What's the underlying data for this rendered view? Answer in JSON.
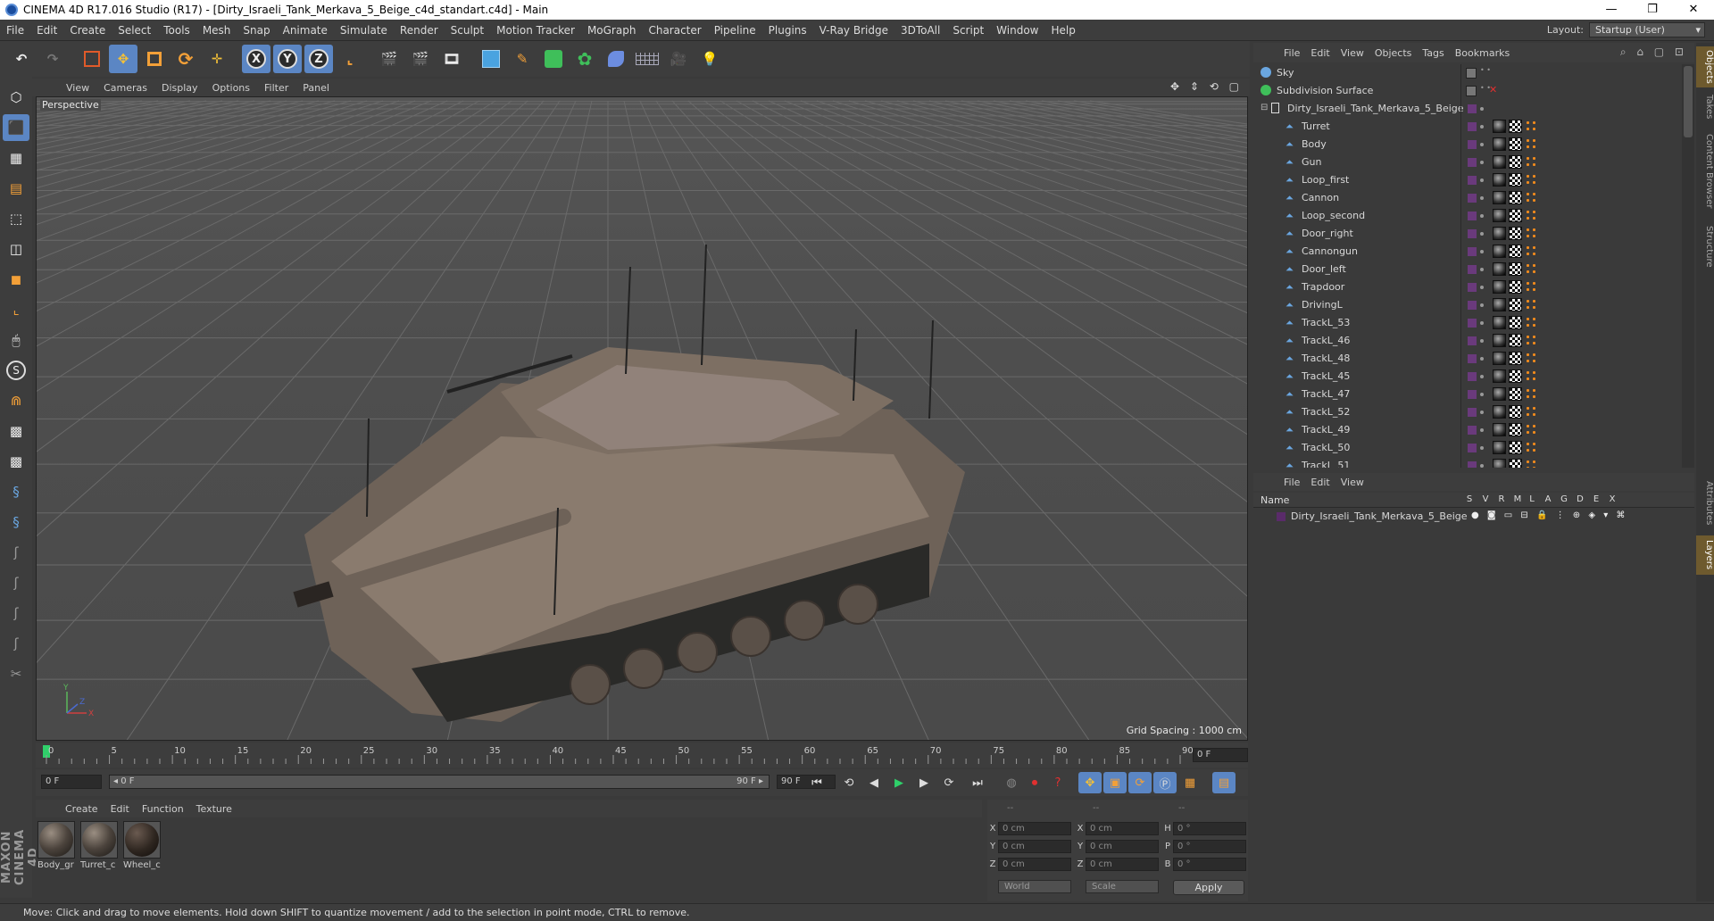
{
  "window": {
    "title": "CINEMA 4D R17.016 Studio (R17) - [Dirty_Israeli_Tank_Merkava_5_Beige_c4d_standart.c4d] - Main",
    "controls": [
      "—",
      "❐",
      "✕"
    ]
  },
  "menu": [
    "File",
    "Edit",
    "Create",
    "Select",
    "Tools",
    "Mesh",
    "Snap",
    "Animate",
    "Simulate",
    "Render",
    "Sculpt",
    "Motion Tracker",
    "MoGraph",
    "Character",
    "Pipeline",
    "Plugins",
    "V-Ray Bridge",
    "3DToAll",
    "Script",
    "Window",
    "Help"
  ],
  "layout": {
    "label": "Layout:",
    "value": "Startup (User)"
  },
  "toolbar": {
    "x_label": "X",
    "y_label": "Y",
    "z_label": "Z"
  },
  "left_tools": {
    "s_label": "S"
  },
  "viewport": {
    "menu": [
      "View",
      "Cameras",
      "Display",
      "Options",
      "Filter",
      "Panel"
    ],
    "camera_label": "Perspective",
    "grid_spacing": "Grid Spacing : 1000 cm",
    "axis_labels": {
      "y": "Y",
      "x": "X",
      "z": "Z"
    }
  },
  "timeline": {
    "ticks": [
      "0",
      "5",
      "10",
      "15",
      "20",
      "25",
      "30",
      "35",
      "40",
      "45",
      "50",
      "55",
      "60",
      "65",
      "70",
      "75",
      "80",
      "85",
      "90"
    ],
    "current_frame_box": "0 F",
    "start_field": "0 F",
    "range_start": "◂ 0 F",
    "range_end": "90 F ▸",
    "end_field": "90 F"
  },
  "material_manager": {
    "menu": [
      "Create",
      "Edit",
      "Function",
      "Texture"
    ],
    "materials": [
      {
        "name": "Body_gr"
      },
      {
        "name": "Turret_c"
      },
      {
        "name": "Wheel_c"
      }
    ]
  },
  "coordinates": {
    "header_dash1": "--",
    "header_dash2": "--",
    "header_dash3": "--",
    "rows": [
      {
        "a": "X",
        "a_val": "0 cm",
        "b": "X",
        "b_val": "0 cm",
        "c": "H",
        "c_val": "0 °"
      },
      {
        "a": "Y",
        "a_val": "0 cm",
        "b": "Y",
        "b_val": "0 cm",
        "c": "P",
        "c_val": "0 °"
      },
      {
        "a": "Z",
        "a_val": "0 cm",
        "b": "Z",
        "b_val": "0 cm",
        "c": "B",
        "c_val": "0 °"
      }
    ],
    "world_select": "World",
    "scale_select": "Scale",
    "apply_label": "Apply"
  },
  "status_text": "Move: Click and drag to move elements. Hold down SHIFT to quantize movement / add to the selection in point mode, CTRL to remove.",
  "branding": {
    "logo": "MAXON CINEMA 4D"
  },
  "object_manager": {
    "menu": [
      "File",
      "Edit",
      "View",
      "Objects",
      "Tags",
      "Bookmarks"
    ],
    "objects": [
      {
        "name": "Sky",
        "type": "sky"
      },
      {
        "name": "Subdivision Surface",
        "type": "subdiv"
      },
      {
        "name": "Dirty_Israeli_Tank_Merkava_5_Beige",
        "type": "null"
      },
      {
        "name": "Turret",
        "type": "poly"
      },
      {
        "name": "Body",
        "type": "poly"
      },
      {
        "name": "Gun",
        "type": "poly"
      },
      {
        "name": "Loop_first",
        "type": "poly"
      },
      {
        "name": "Cannon",
        "type": "poly"
      },
      {
        "name": "Loop_second",
        "type": "poly"
      },
      {
        "name": "Door_right",
        "type": "poly"
      },
      {
        "name": "Cannongun",
        "type": "poly"
      },
      {
        "name": "Door_left",
        "type": "poly"
      },
      {
        "name": "Trapdoor",
        "type": "poly"
      },
      {
        "name": "DrivingL",
        "type": "poly"
      },
      {
        "name": "TrackL_53",
        "type": "poly"
      },
      {
        "name": "TrackL_46",
        "type": "poly"
      },
      {
        "name": "TrackL_48",
        "type": "poly"
      },
      {
        "name": "TrackL_45",
        "type": "poly"
      },
      {
        "name": "TrackL_47",
        "type": "poly"
      },
      {
        "name": "TrackL_52",
        "type": "poly"
      },
      {
        "name": "TrackL_49",
        "type": "poly"
      },
      {
        "name": "TrackL_50",
        "type": "poly"
      },
      {
        "name": "TrackL_51",
        "type": "poly"
      }
    ]
  },
  "layer_manager": {
    "menu": [
      "File",
      "Edit",
      "View"
    ],
    "columns": [
      "S",
      "V",
      "R",
      "M",
      "L",
      "A",
      "G",
      "D",
      "E",
      "X"
    ],
    "name_header": "Name",
    "layers": [
      {
        "name": "Dirty_Israeli_Tank_Merkava_5_Beige"
      }
    ]
  },
  "side_tabs": [
    "Objects",
    "Takes",
    "Content Browser",
    "Structure",
    "Attributes",
    "Layers"
  ],
  "colors": {
    "accent": "#5b86c4",
    "layer": "#5a2b6a",
    "tag_orange": "#f08a1c"
  }
}
